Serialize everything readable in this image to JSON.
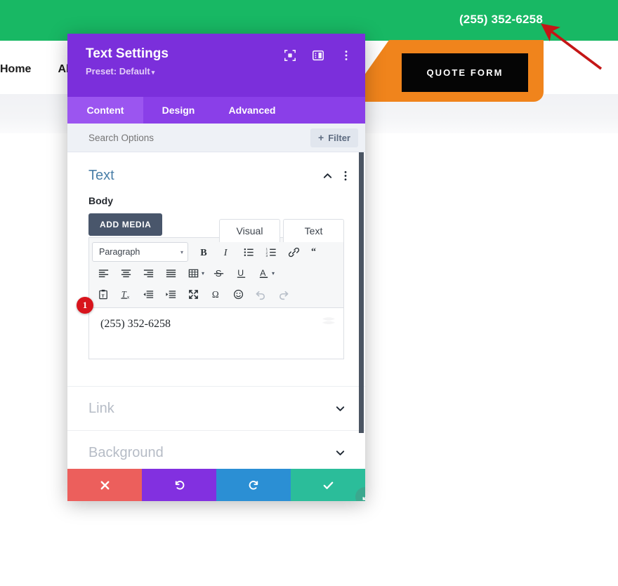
{
  "background_page": {
    "top_bar": {
      "phone": "(255) 352-6258",
      "color": "#18b864"
    },
    "nav": {
      "items": [
        "Home",
        "Abo"
      ]
    },
    "orange_shape_color": "#f0841c",
    "quote_button": {
      "label": "QUOTE FORM",
      "bg": "#050505",
      "text_color": "#ffffff"
    },
    "annotation_arrow": {
      "name": "red-arrow",
      "color": "#c41616"
    }
  },
  "modal": {
    "title": "Text Settings",
    "preset": "Preset: Default",
    "preset_caret": "▾",
    "header_icons": [
      "focus-icon",
      "layout-panel-icon",
      "vertical-dots-icon"
    ],
    "tabs": [
      {
        "label": "Content",
        "active": true
      },
      {
        "label": "Design",
        "active": false
      },
      {
        "label": "Advanced",
        "active": false
      }
    ],
    "search": {
      "placeholder": "Search Options",
      "value": ""
    },
    "filter_button": {
      "label": "Filter",
      "plus": "+"
    },
    "sections": [
      {
        "title": "Text",
        "state": "expanded",
        "chevron": "chevron-up-icon"
      },
      {
        "title": "Link",
        "state": "collapsed",
        "chevron": "chevron-down-icon"
      },
      {
        "title": "Background",
        "state": "collapsed",
        "chevron": "chevron-down-icon"
      }
    ],
    "text_section": {
      "field_label": "Body",
      "add_media_label": "ADD MEDIA",
      "editor_tabs": [
        {
          "label": "Visual",
          "active": true
        },
        {
          "label": "Text",
          "active": false
        }
      ],
      "format_select": {
        "value": "Paragraph",
        "caret": "▾"
      },
      "toolbar_row1": [
        "bold-icon",
        "italic-icon",
        "bulleted-list-icon",
        "numbered-list-icon",
        "link-icon",
        "blockquote-icon"
      ],
      "toolbar_row2": [
        "align-left-icon",
        "align-center-icon",
        "align-right-icon",
        "align-justify-icon",
        "table-icon",
        "strikethrough-icon",
        "underline-icon",
        "text-color-icon"
      ],
      "toolbar_row3": [
        "paste-as-text-icon",
        "clear-formatting-icon",
        "outdent-icon",
        "indent-icon",
        "fullscreen-icon",
        "special-character-icon",
        "emoji-icon",
        "undo-icon",
        "redo-icon"
      ],
      "content_value": "(255) 352-6258",
      "step_badge": "1"
    },
    "footer_buttons": [
      {
        "name": "cancel",
        "icon": "close-icon",
        "color": "#ec5f5c"
      },
      {
        "name": "undo",
        "icon": "undo-arrow-icon",
        "color": "#8230e0"
      },
      {
        "name": "redo",
        "icon": "redo-arrow-icon",
        "color": "#2b8fd4"
      },
      {
        "name": "save",
        "icon": "check-icon",
        "color": "#2bbd9a"
      }
    ],
    "resize_handle": "resize-diagonal-icon",
    "accent_color": "#7b2fdb"
  }
}
